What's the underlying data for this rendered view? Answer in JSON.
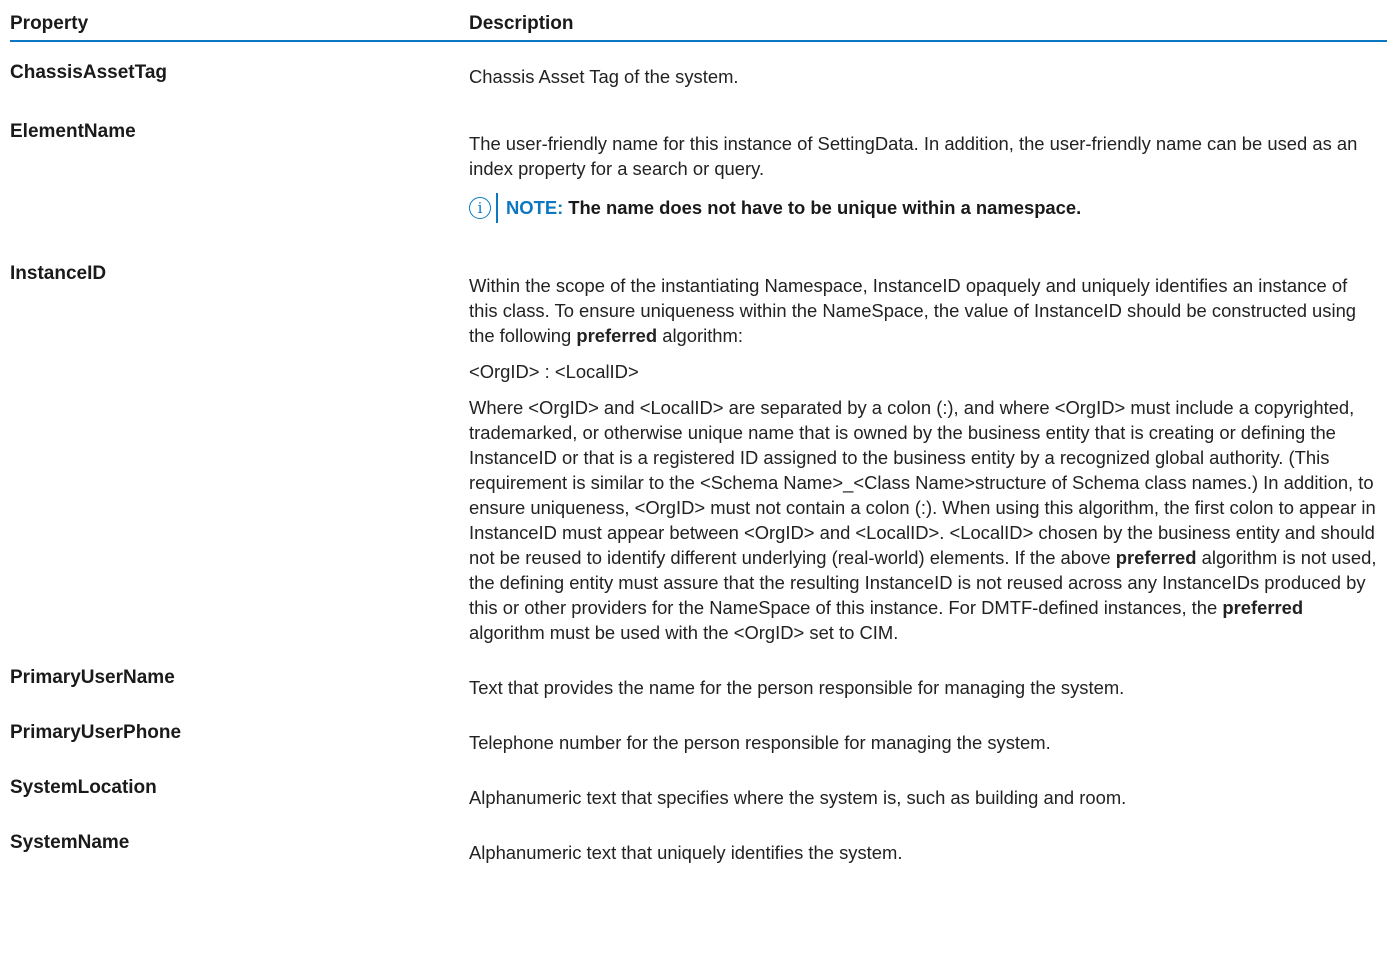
{
  "table": {
    "headers": {
      "property": "Property",
      "description": "Description"
    },
    "rows": [
      {
        "property": "ChassisAssetTag",
        "description": "Chassis Asset Tag of the system."
      },
      {
        "property": "ElementName",
        "description": "The user-friendly name for this instance of SettingData. In addition, the user-friendly name can be used as an index property for a search or query.",
        "note": {
          "label": "NOTE:",
          "text": "The name does not have to be unique within a namespace."
        }
      },
      {
        "property": "InstanceID",
        "para1_a": "Within the scope of the instantiating Namespace, InstanceID opaquely and uniquely identifies an instance of this class. To ensure uniqueness within the NameSpace, the value of InstanceID should be constructed using the following ",
        "para1_b": "preferred",
        "para1_c": " algorithm:",
        "para2": "<OrgID> : <LocalID>",
        "para3_a": "Where <OrgID> and <LocalID> are separated by a colon (:), and where <OrgID> must include a copyrighted, trademarked, or otherwise unique name that is owned by the business entity that is creating or defining the InstanceID or that is a registered ID assigned to the business entity by a recognized global authority. (This requirement is similar to the <Schema Name>_<Class Name>structure of Schema class names.) In addition, to ensure uniqueness, <OrgID> must not contain a colon (:). When using this algorithm, the first colon to appear in InstanceID must appear between <OrgID> and <LocalID>. <LocalID> chosen by the business entity and should not be reused to identify different underlying (real-world) elements. If the above ",
        "para3_b": "preferred",
        "para3_c": " algorithm is not used, the defining entity must assure that the resulting InstanceID is not reused across any InstanceIDs produced by this or other providers for the NameSpace of this instance. For DMTF-defined instances, the ",
        "para3_d": "preferred",
        "para3_e": " algorithm must be used with the <OrgID> set to CIM."
      },
      {
        "property": "PrimaryUserName",
        "description": "Text that provides the name for the person responsible for managing the system."
      },
      {
        "property": "PrimaryUserPhone",
        "description": "Telephone number for the person responsible for managing the system."
      },
      {
        "property": "SystemLocation",
        "description": "Alphanumeric text that specifies where the system is, such as building and room."
      },
      {
        "property": "SystemName",
        "description": "Alphanumeric text that uniquely identifies the system."
      }
    ]
  },
  "colors": {
    "accent": "#0b78c1",
    "text": "#1a1a1a"
  },
  "icons": {
    "note": "info-circle-icon",
    "note_glyph": "i"
  }
}
